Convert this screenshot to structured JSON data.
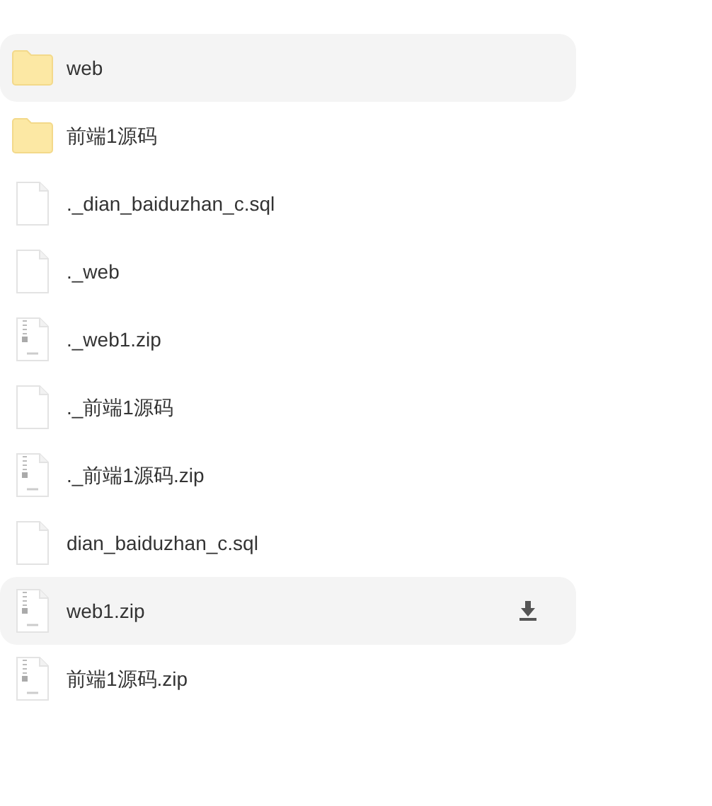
{
  "files": [
    {
      "name": "web",
      "kind": "folder",
      "highlighted": true,
      "download": false
    },
    {
      "name": "前端1源码",
      "kind": "folder",
      "highlighted": false,
      "download": false
    },
    {
      "name": "._dian_baiduzhan_c.sql",
      "kind": "file",
      "highlighted": false,
      "download": false
    },
    {
      "name": "._web",
      "kind": "file",
      "highlighted": false,
      "download": false
    },
    {
      "name": "._web1.zip",
      "kind": "zip",
      "highlighted": false,
      "download": false
    },
    {
      "name": "._前端1源码",
      "kind": "file",
      "highlighted": false,
      "download": false
    },
    {
      "name": "._前端1源码.zip",
      "kind": "zip",
      "highlighted": false,
      "download": false
    },
    {
      "name": "dian_baiduzhan_c.sql",
      "kind": "file",
      "highlighted": false,
      "download": false
    },
    {
      "name": "web1.zip",
      "kind": "zip",
      "highlighted": true,
      "download": true
    },
    {
      "name": "前端1源码.zip",
      "kind": "zip",
      "highlighted": false,
      "download": false
    }
  ]
}
